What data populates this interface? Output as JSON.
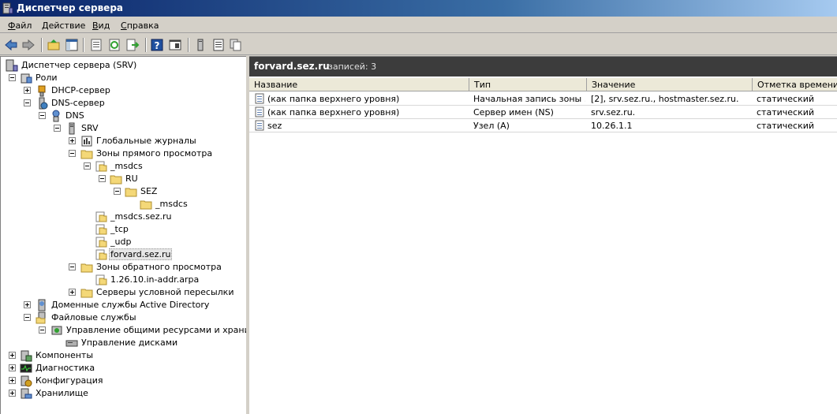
{
  "window": {
    "title": "Диспетчер сервера"
  },
  "menu": [
    "Файл",
    "Действие",
    "Вид",
    "Справка"
  ],
  "toolbar": [
    "back-arrow-icon",
    "forward-arrow-icon",
    "up-folder-icon",
    "show-tree-icon",
    "properties-icon",
    "refresh-icon",
    "export-icon",
    "help-icon",
    "console-icon",
    "server-icon",
    "list-icon",
    "copy-icon"
  ],
  "tree": [
    {
      "label": "Диспетчер сервера (SRV)",
      "icon": "server-manager-icon"
    },
    {
      "label": "Роли",
      "icon": "roles-icon"
    },
    {
      "label": "DHCP-сервер",
      "icon": "dhcp-icon"
    },
    {
      "label": "DNS-сервер",
      "icon": "dns-server-icon"
    },
    {
      "label": "DNS",
      "icon": "dns-icon"
    },
    {
      "label": "SRV",
      "icon": "server-icon"
    },
    {
      "label": "Глобальные журналы",
      "icon": "logs-icon"
    },
    {
      "label": "Зоны прямого просмотра",
      "icon": "folder-icon"
    },
    {
      "label": "_msdcs",
      "icon": "zone-icon"
    },
    {
      "label": "RU",
      "icon": "folder-icon"
    },
    {
      "label": "SEZ",
      "icon": "folder-icon"
    },
    {
      "label": "_msdcs",
      "icon": "folder-icon"
    },
    {
      "label": "_msdcs.sez.ru",
      "icon": "zone-icon"
    },
    {
      "label": "_tcp",
      "icon": "zone-icon"
    },
    {
      "label": "_udp",
      "icon": "zone-icon"
    },
    {
      "label": "forvard.sez.ru",
      "icon": "zone-icon"
    },
    {
      "label": "Зоны обратного просмотра",
      "icon": "folder-icon"
    },
    {
      "label": "1.26.10.in-addr.arpa",
      "icon": "zone-icon"
    },
    {
      "label": "Серверы условной пересылки",
      "icon": "folder-icon"
    },
    {
      "label": "Доменные службы Active Directory",
      "icon": "ad-icon"
    },
    {
      "label": "Файловые службы",
      "icon": "file-services-icon"
    },
    {
      "label": "Управление общими ресурсами и хранилища",
      "icon": "share-icon"
    },
    {
      "label": "Управление дисками",
      "icon": "disk-icon"
    },
    {
      "label": "Компоненты",
      "icon": "features-icon"
    },
    {
      "label": "Диагностика",
      "icon": "diagnostics-icon"
    },
    {
      "label": "Конфигурация",
      "icon": "config-icon"
    },
    {
      "label": "Хранилище",
      "icon": "storage-icon"
    }
  ],
  "list": {
    "title": "forvard.sez.ru",
    "count": "записей: 3",
    "columns": [
      "Название",
      "Тип",
      "Значение",
      "Отметка времени"
    ],
    "rows": [
      [
        "(как папка верхнего уровня)",
        "Начальная запись зоны ...",
        "[2], srv.sez.ru., hostmaster.sez.ru.",
        "статический"
      ],
      [
        "(как папка верхнего уровня)",
        "Сервер имен (NS)",
        "srv.sez.ru.",
        "статический"
      ],
      [
        "sez",
        "Узел (A)",
        "10.26.1.1",
        "статический"
      ]
    ]
  }
}
